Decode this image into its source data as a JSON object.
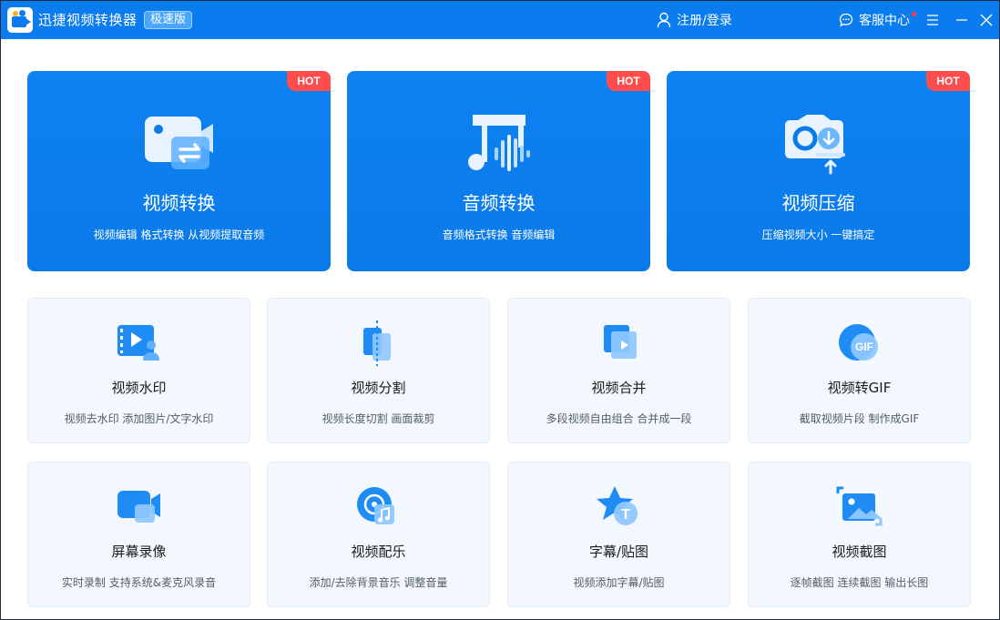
{
  "titlebar": {
    "app_title": "迅捷视频转换器",
    "edition": "极速版",
    "login": "注册/登录",
    "service": "客服中心"
  },
  "big_cards": [
    {
      "title": "视频转换",
      "subtitle": "视频编辑 格式转换 从视频提取音频",
      "badge": "HOT",
      "icon": "video-convert-icon"
    },
    {
      "title": "音频转换",
      "subtitle": "音频格式转换 音频编辑",
      "badge": "HOT",
      "icon": "audio-convert-icon"
    },
    {
      "title": "视频压缩",
      "subtitle": "压缩视频大小 一键搞定",
      "badge": "HOT",
      "icon": "video-compress-icon"
    }
  ],
  "cards": [
    {
      "title": "视频水印",
      "subtitle": "视频去水印 添加图片/文字水印",
      "icon": "watermark-icon"
    },
    {
      "title": "视频分割",
      "subtitle": "视频长度切割 画面裁剪",
      "icon": "split-icon"
    },
    {
      "title": "视频合并",
      "subtitle": "多段视频自由组合 合并成一段",
      "icon": "merge-icon"
    },
    {
      "title": "视频转GIF",
      "subtitle": "截取视频片段 制作成GIF",
      "icon": "gif-icon",
      "icon_text": "GIF"
    },
    {
      "title": "屏幕录像",
      "subtitle": "实时录制 支持系统&麦克风录音",
      "icon": "screen-record-icon"
    },
    {
      "title": "视频配乐",
      "subtitle": "添加/去除背景音乐 调整音量",
      "icon": "music-icon"
    },
    {
      "title": "字幕/贴图",
      "subtitle": "视频添加字幕/贴图",
      "icon": "subtitle-icon",
      "icon_text": "T"
    },
    {
      "title": "视频截图",
      "subtitle": "逐帧截图 连续截图 输出长图",
      "icon": "screenshot-icon"
    }
  ],
  "colors": {
    "titlebar": "#0a7cf0",
    "big_card": "#0b7ae9",
    "hot_badge": "#ff4c4c",
    "card_bg": "#f2f8fe"
  }
}
